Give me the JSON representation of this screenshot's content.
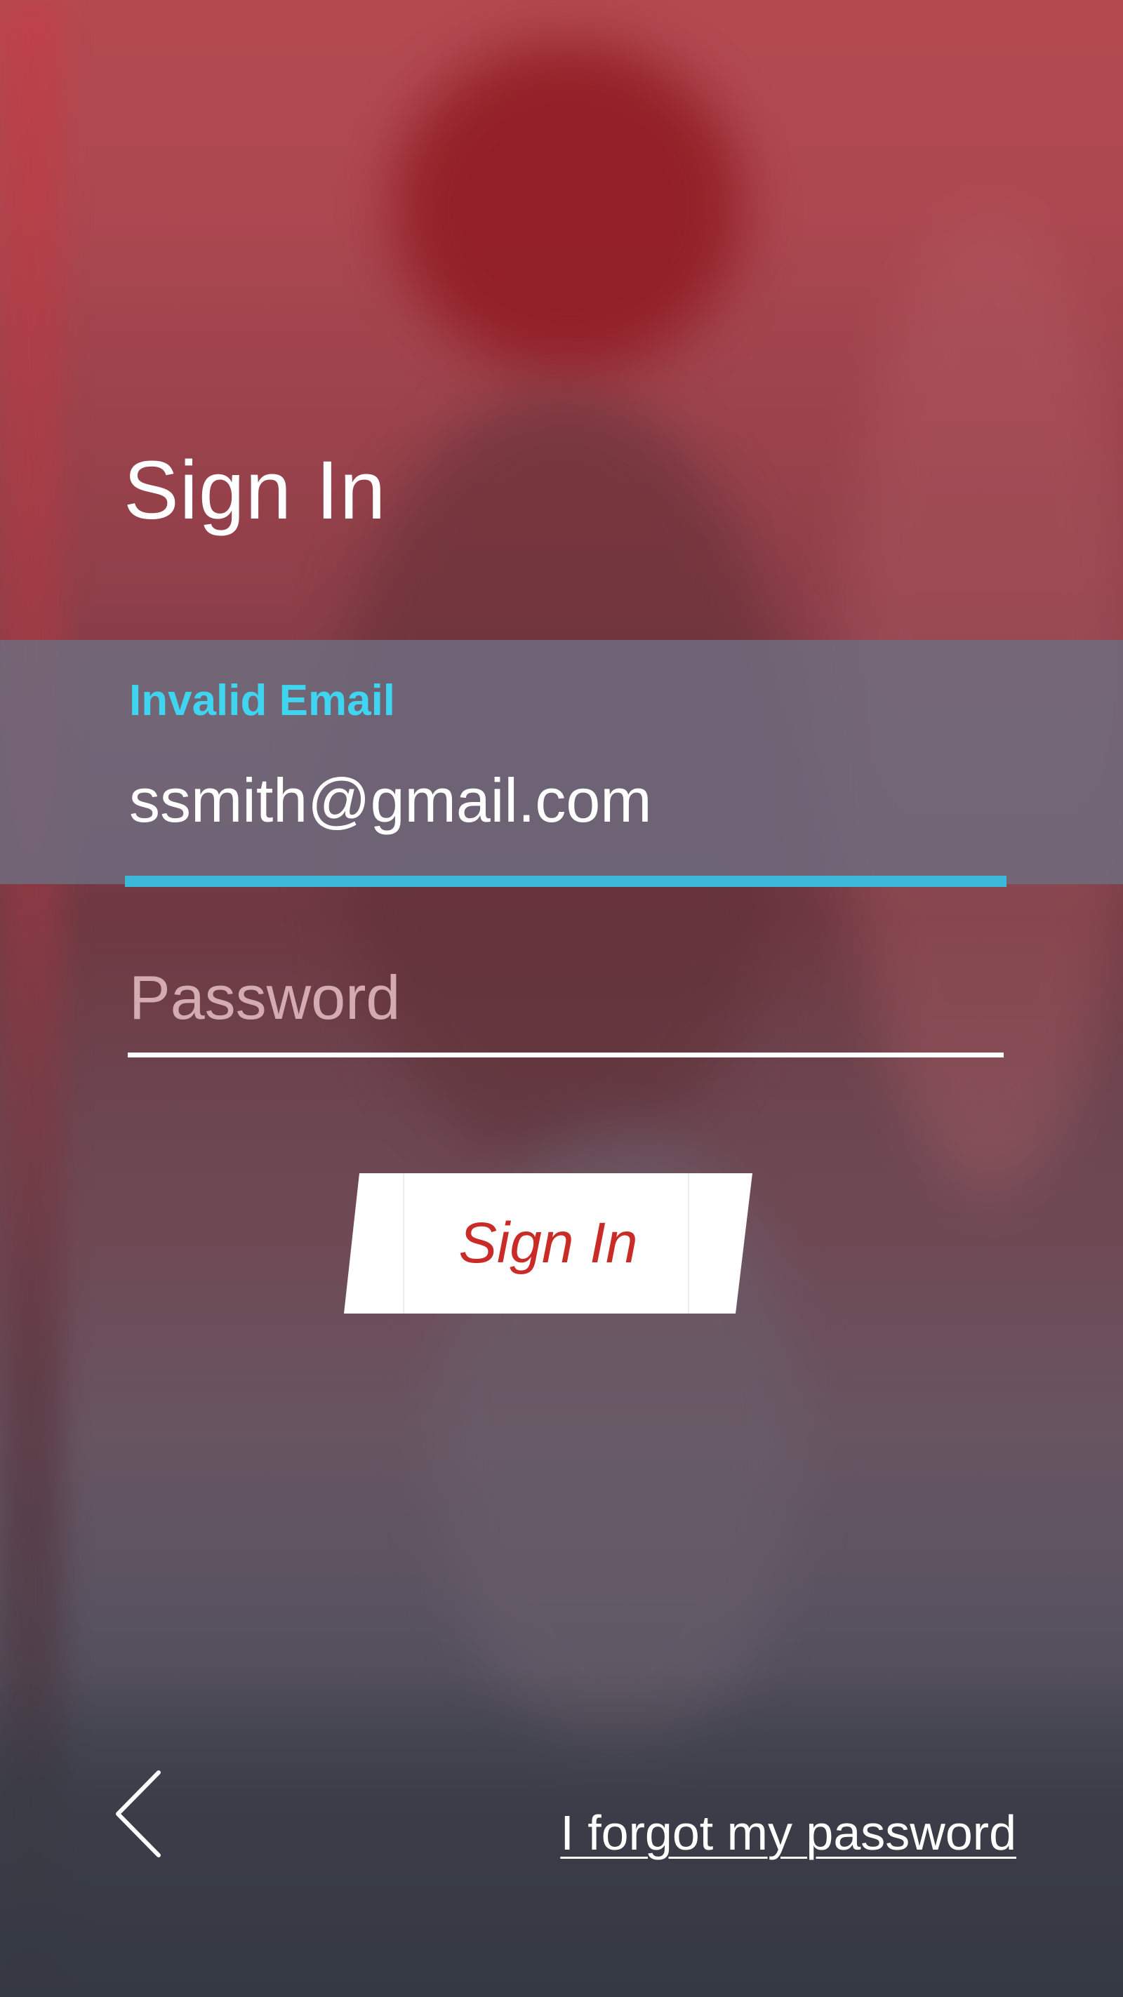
{
  "page": {
    "title": "Sign In"
  },
  "email": {
    "error_label": "Invalid Email",
    "value": "ssmith@gmail.com",
    "accent_color": "#3cb8d8",
    "error_color": "#3fd4ef"
  },
  "password": {
    "placeholder": "Password"
  },
  "signin_button": {
    "label": "Sign In",
    "text_color": "#c92c27"
  },
  "footer": {
    "back_icon": "chevron-left-icon",
    "forgot_label": "I forgot my password"
  }
}
